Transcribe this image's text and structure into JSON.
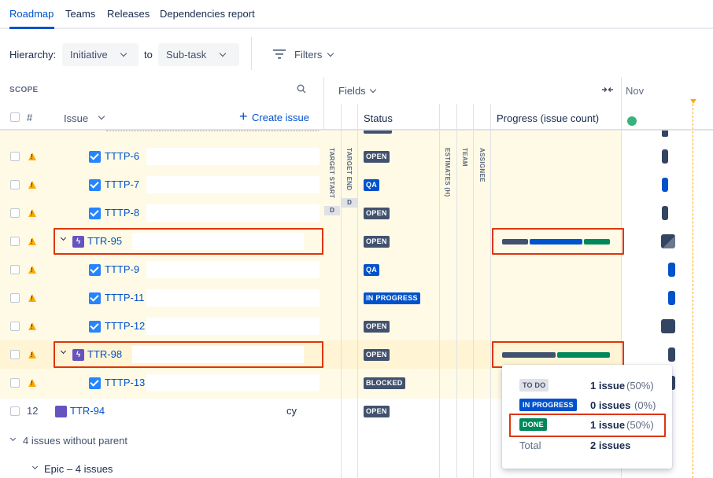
{
  "tabs": [
    "Roadmap",
    "Teams",
    "Releases",
    "Dependencies report"
  ],
  "toolbar": {
    "hierarchy_label": "Hierarchy:",
    "from_value": "Initiative",
    "to_label": "to",
    "to_value": "Sub-task",
    "filters_label": "Filters"
  },
  "scope_panel": {
    "title": "SCOPE",
    "col_num": "#",
    "col_issue": "Issue",
    "create_issue": "Create issue"
  },
  "fields_panel": {
    "title": "Fields",
    "col_status": "Status",
    "col_progress": "Progress (issue count)",
    "vert_headers": [
      "TARGET START",
      "TARGET END",
      "ESTIMATES (H)",
      "TEAM",
      "ASSIGNEE"
    ],
    "date_badge": "D"
  },
  "timeline": {
    "month": "Nov"
  },
  "rows": [
    {
      "key": "TTTP-6",
      "status": "OPEN",
      "status_color": "#42526e",
      "type": "task"
    },
    {
      "key": "TTTP-7",
      "status": "QA",
      "status_color": "#0052cc",
      "type": "task"
    },
    {
      "key": "TTTP-8",
      "status": "OPEN",
      "status_color": "#42526e",
      "type": "task"
    },
    {
      "key": "TTR-95",
      "status": "OPEN",
      "status_color": "#42526e",
      "type": "epic"
    },
    {
      "key": "TTTP-9",
      "status": "QA",
      "status_color": "#0052cc",
      "type": "task"
    },
    {
      "key": "TTTP-11",
      "status": "IN PROGRESS",
      "status_color": "#0052cc",
      "type": "task"
    },
    {
      "key": "TTTP-12",
      "status": "OPEN",
      "status_color": "#42526e",
      "type": "task"
    },
    {
      "key": "TTR-98",
      "status": "OPEN",
      "status_color": "#42526e",
      "type": "epic"
    },
    {
      "key": "TTTP-13",
      "status": "BLOCKED",
      "status_color": "#42526e",
      "type": "task"
    },
    {
      "num": "12",
      "key": "TTR-94",
      "trailing": "cy",
      "status": "OPEN",
      "status_color": "#42526e",
      "type": "story"
    }
  ],
  "groups": {
    "without_parent": "4 issues without parent",
    "epic_group": "Epic – 4 issues"
  },
  "progress": {
    "ttr95": {
      "todo": 1,
      "in_progress": 1,
      "done": 1
    },
    "ttr98": {
      "todo": 1,
      "in_progress": 0,
      "done": 1
    }
  },
  "popover": {
    "items": [
      {
        "status": "TO DO",
        "count": "1 issue",
        "pct": "(50%)",
        "bg": "#dfe1e6",
        "fg": "#42526e"
      },
      {
        "status": "IN PROGRESS",
        "count": "0 issues",
        "pct": "(0%)",
        "bg": "#0052cc",
        "fg": "#ffffff"
      },
      {
        "status": "DONE",
        "count": "1 issue",
        "pct": "(50%)",
        "bg": "#00875a",
        "fg": "#ffffff"
      }
    ],
    "total_label": "Total",
    "total_value": "2 issues"
  },
  "colors": {
    "accent": "#0052cc",
    "highlight": "#de350b",
    "row_bg": "#fffae6"
  }
}
